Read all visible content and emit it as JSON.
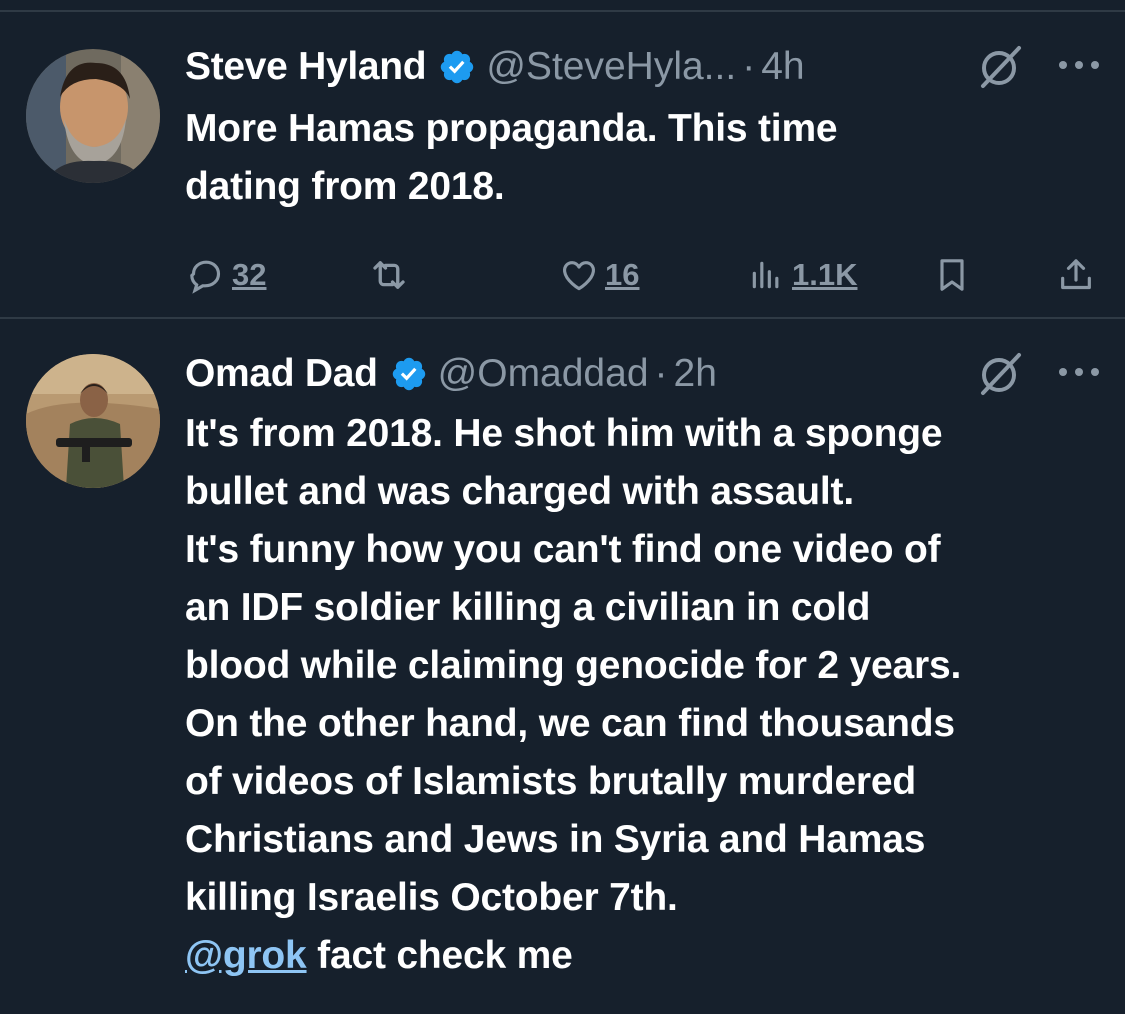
{
  "tweets": [
    {
      "name": "Steve Hyland",
      "handle": "@SteveHyla...",
      "dot": "·",
      "time": "4h",
      "lines": [
        "More Hamas propaganda.  This time",
        "dating from 2018."
      ],
      "stats": {
        "replies": "32",
        "likes": "16",
        "views": "1.1K"
      }
    },
    {
      "name": "Omad Dad",
      "handle": "@Omaddad",
      "dot": "·",
      "time": "2h",
      "lines": [
        "It's from 2018. He shot him with a sponge",
        "bullet and was charged with assault.",
        "It's funny how you can't find one video of",
        "an IDF soldier killing a civilian in cold",
        "blood while claiming genocide for 2 years.",
        "On the other hand, we can find thousands",
        "of videos of Islamists brutally murdered",
        "Christians and Jews in Syria and Hamas",
        "killing Israelis October 7th."
      ],
      "mention": "@grok",
      "mention_rest": " fact check me"
    }
  ],
  "icons": {
    "verified": "verified-badge-icon",
    "grok": "grok-icon",
    "more": "more-icon",
    "reply": "reply-icon",
    "retweet": "retweet-icon",
    "like": "like-icon",
    "views": "views-icon",
    "bookmark": "bookmark-icon",
    "share": "share-icon"
  },
  "colors": {
    "background": "#16202c",
    "text": "#ffffff",
    "secondary": "#8b98a5",
    "verified": "#1d9bf0",
    "link": "#8ec5f4",
    "divider": "#2f3a45"
  }
}
